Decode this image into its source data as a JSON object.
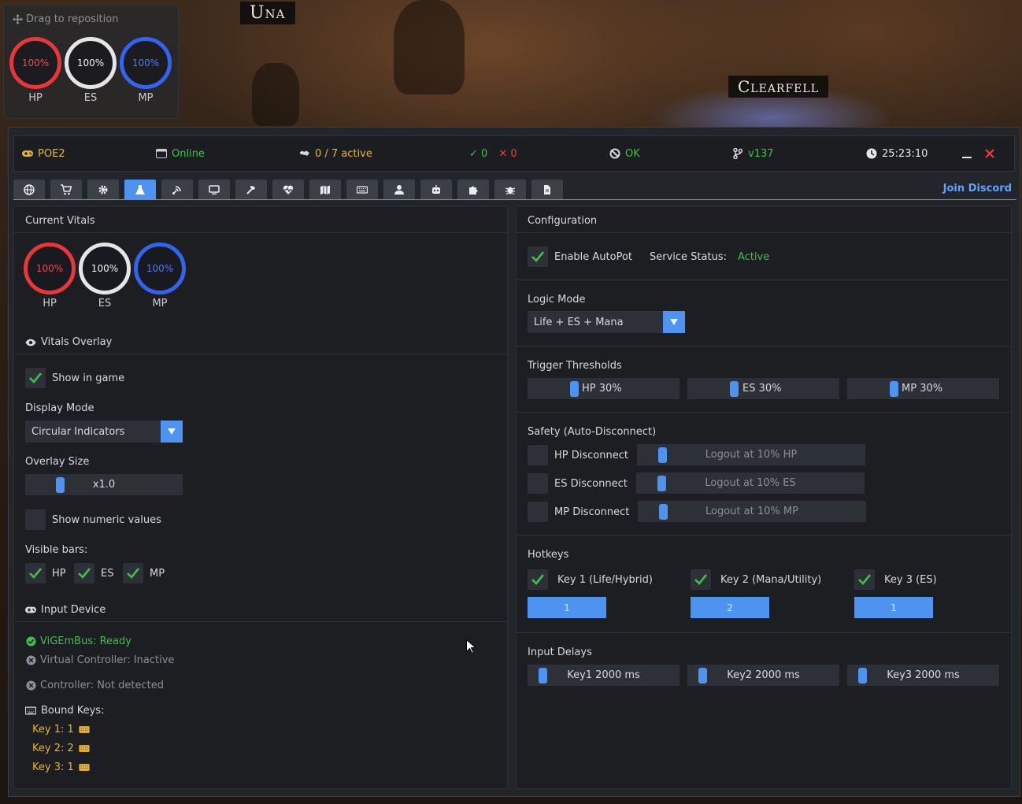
{
  "overlay_mini": {
    "drag_text": "Drag to reposition",
    "vitals": [
      {
        "label": "HP",
        "value": "100%"
      },
      {
        "label": "ES",
        "value": "100%"
      },
      {
        "label": "MP",
        "value": "100%"
      }
    ]
  },
  "scene": {
    "label_una": "Una",
    "label_clearfell": "Clearfell"
  },
  "status": {
    "game": "POE2",
    "connection": "Online",
    "active": "0 / 7 active",
    "ok_count": "0",
    "fail_count": "0",
    "state": "OK",
    "version": "v137",
    "clock": "25:23:10"
  },
  "tabs": [
    {
      "icon": "globe-icon"
    },
    {
      "icon": "cart-icon"
    },
    {
      "icon": "gear-icon"
    },
    {
      "icon": "flask-icon",
      "active": true
    },
    {
      "icon": "satellite-icon"
    },
    {
      "icon": "monitor-icon"
    },
    {
      "icon": "hammer-icon"
    },
    {
      "icon": "heartbeat-icon"
    },
    {
      "icon": "map-icon"
    },
    {
      "icon": "keyboard-icon"
    },
    {
      "icon": "user-icon"
    },
    {
      "icon": "robot-icon"
    },
    {
      "icon": "puzzle-icon"
    },
    {
      "icon": "bug-icon"
    },
    {
      "icon": "file-icon"
    }
  ],
  "join_discord": "Join Discord",
  "left": {
    "current_vitals_title": "Current Vitals",
    "vitals": [
      {
        "label": "HP",
        "value": "100%"
      },
      {
        "label": "ES",
        "value": "100%"
      },
      {
        "label": "MP",
        "value": "100%"
      }
    ],
    "vitals_overlay_title": "Vitals Overlay",
    "show_in_game": "Show in game",
    "display_mode_label": "Display Mode",
    "display_mode_value": "Circular Indicators",
    "overlay_size_label": "Overlay Size",
    "overlay_size_value": "x1.0",
    "show_numeric": "Show numeric values",
    "visible_bars_label": "Visible bars:",
    "bar_hp": "HP",
    "bar_es": "ES",
    "bar_mp": "MP",
    "input_device_title": "Input Device",
    "vigembus": "ViGEmBus: Ready",
    "virtual_controller": "Virtual Controller: Inactive",
    "controller": "Controller: Not detected",
    "bound_keys_label": "Bound Keys:",
    "bound_keys": [
      "Key 1: 1",
      "Key 2: 2",
      "Key 3: 1"
    ]
  },
  "right": {
    "configuration_title": "Configuration",
    "enable_autopot": "Enable AutoPot",
    "service_status_label": "Service Status:",
    "service_status_value": "Active",
    "logic_mode_label": "Logic Mode",
    "logic_mode_value": "Life + ES + Mana",
    "trigger_title": "Trigger Thresholds",
    "thresholds": [
      {
        "text": "HP 30%",
        "value": 30
      },
      {
        "text": "ES 30%",
        "value": 30
      },
      {
        "text": "MP 30%",
        "value": 30
      }
    ],
    "safety_title": "Safety (Auto-Disconnect)",
    "safety": [
      {
        "label": "HP Disconnect",
        "slider": "Logout at 10% HP",
        "value": 10
      },
      {
        "label": "ES Disconnect",
        "slider": "Logout at 10% ES",
        "value": 10
      },
      {
        "label": "MP Disconnect",
        "slider": "Logout at 10% MP",
        "value": 10
      }
    ],
    "hotkeys_title": "Hotkeys",
    "hotkeys": [
      {
        "label": "Key 1 (Life/Hybrid)",
        "key": "1"
      },
      {
        "label": "Key 2 (Mana/Utility)",
        "key": "2"
      },
      {
        "label": "Key 3 (ES)",
        "key": "1"
      }
    ],
    "input_delays_title": "Input Delays",
    "delays": [
      "Key1 2000 ms",
      "Key2 2000 ms",
      "Key3 2000 ms"
    ]
  },
  "colors": {
    "accent": "#4e93f0",
    "ok": "#3fbf4d",
    "warning": "#e7b43a",
    "error": "#ef3b3b",
    "hp": "#e8363a",
    "es": "#e5e5e5",
    "mp": "#3264ef"
  }
}
